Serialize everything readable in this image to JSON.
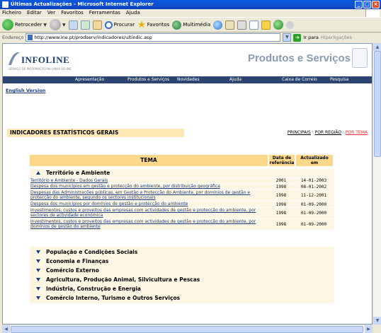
{
  "window": {
    "title": "Últimas Actualizações - Microsoft Internet Explorer"
  },
  "menubar": [
    "Ficheiro",
    "Editar",
    "Ver",
    "Favoritos",
    "Ferramentas",
    "Ajuda"
  ],
  "toolbar": {
    "back": "Retroceder",
    "search": "Procurar",
    "favorites": "Favoritos",
    "multimedia": "Multimédia"
  },
  "address": {
    "label": "Endereço",
    "url": "http://www.ine.pt/prodserv/indicadores/ultindic.asp",
    "go": "Ir para",
    "links": "Hiperligações"
  },
  "site": {
    "logo": "INFOLINE",
    "logo_sub": "SERVIÇO DE INFORMAÇÃO NA LINHA DO INE",
    "title": "Produtos e Serviços",
    "nav": [
      "Apresentação",
      "Produtos e Serviços",
      "Novidades",
      "Ajuda",
      "Caixa de Correio",
      "Pesquisa"
    ],
    "english": "English Version"
  },
  "section": {
    "title": "INDICADORES ESTATÍSTICOS GERAIS",
    "links": {
      "principais": "PRINCIPAIS",
      "sep1": " · ",
      "regiao": "POR REGIÃO",
      "sep2": " · ",
      "tema": "POR TEMA"
    }
  },
  "table": {
    "col_tema": "TEMA",
    "col_data_1": "Data de",
    "col_data_2": "referência",
    "col_atual_1": "Actualizado",
    "col_atual_2": "em",
    "expanded_group": "Território e Ambiente",
    "rows": [
      {
        "name": "Território e Ambiente - Dados Gerais",
        "data": "2001",
        "atual": "14-01-2003"
      },
      {
        "name": "Despesa dos municípios em gestão e protecção do ambiente, por distribuição geográfica",
        "data": "1998",
        "atual": "08-01-2002"
      },
      {
        "name": "Despesas das Administrações públicas, em Gestão e Protecção do Ambiente, por domínios de gestão e protecção do ambiente, segundo os sectores institucionais",
        "data": "1998",
        "atual": "11-12-2001"
      },
      {
        "name": "Despesa dos municípios por domínios de gestão e protecção do ambiente",
        "data": "1998",
        "atual": "01-09-2000"
      },
      {
        "name": "Investimentos, custos e proveitos das empresas com actividades de gestão e protecção do ambiente, por sectores de actividade económica",
        "data": "1998",
        "atual": "01-09-2000"
      },
      {
        "name": "Investimentos, custos e proveitos das empresas com actividades de gestão e protecção do ambiente, por domínios de gestão do ambiente",
        "data": "1998",
        "atual": "01-09-2000"
      }
    ],
    "collapsed_groups": [
      "População e Condições Sociais",
      "Economia e Finanças",
      "Comércio Externo",
      "Agricultura, Produção Animal, Silvicultura e Pescas",
      "Indústria, Construção e Energia",
      "Comércio Interno, Turismo e Outros Serviços"
    ]
  }
}
